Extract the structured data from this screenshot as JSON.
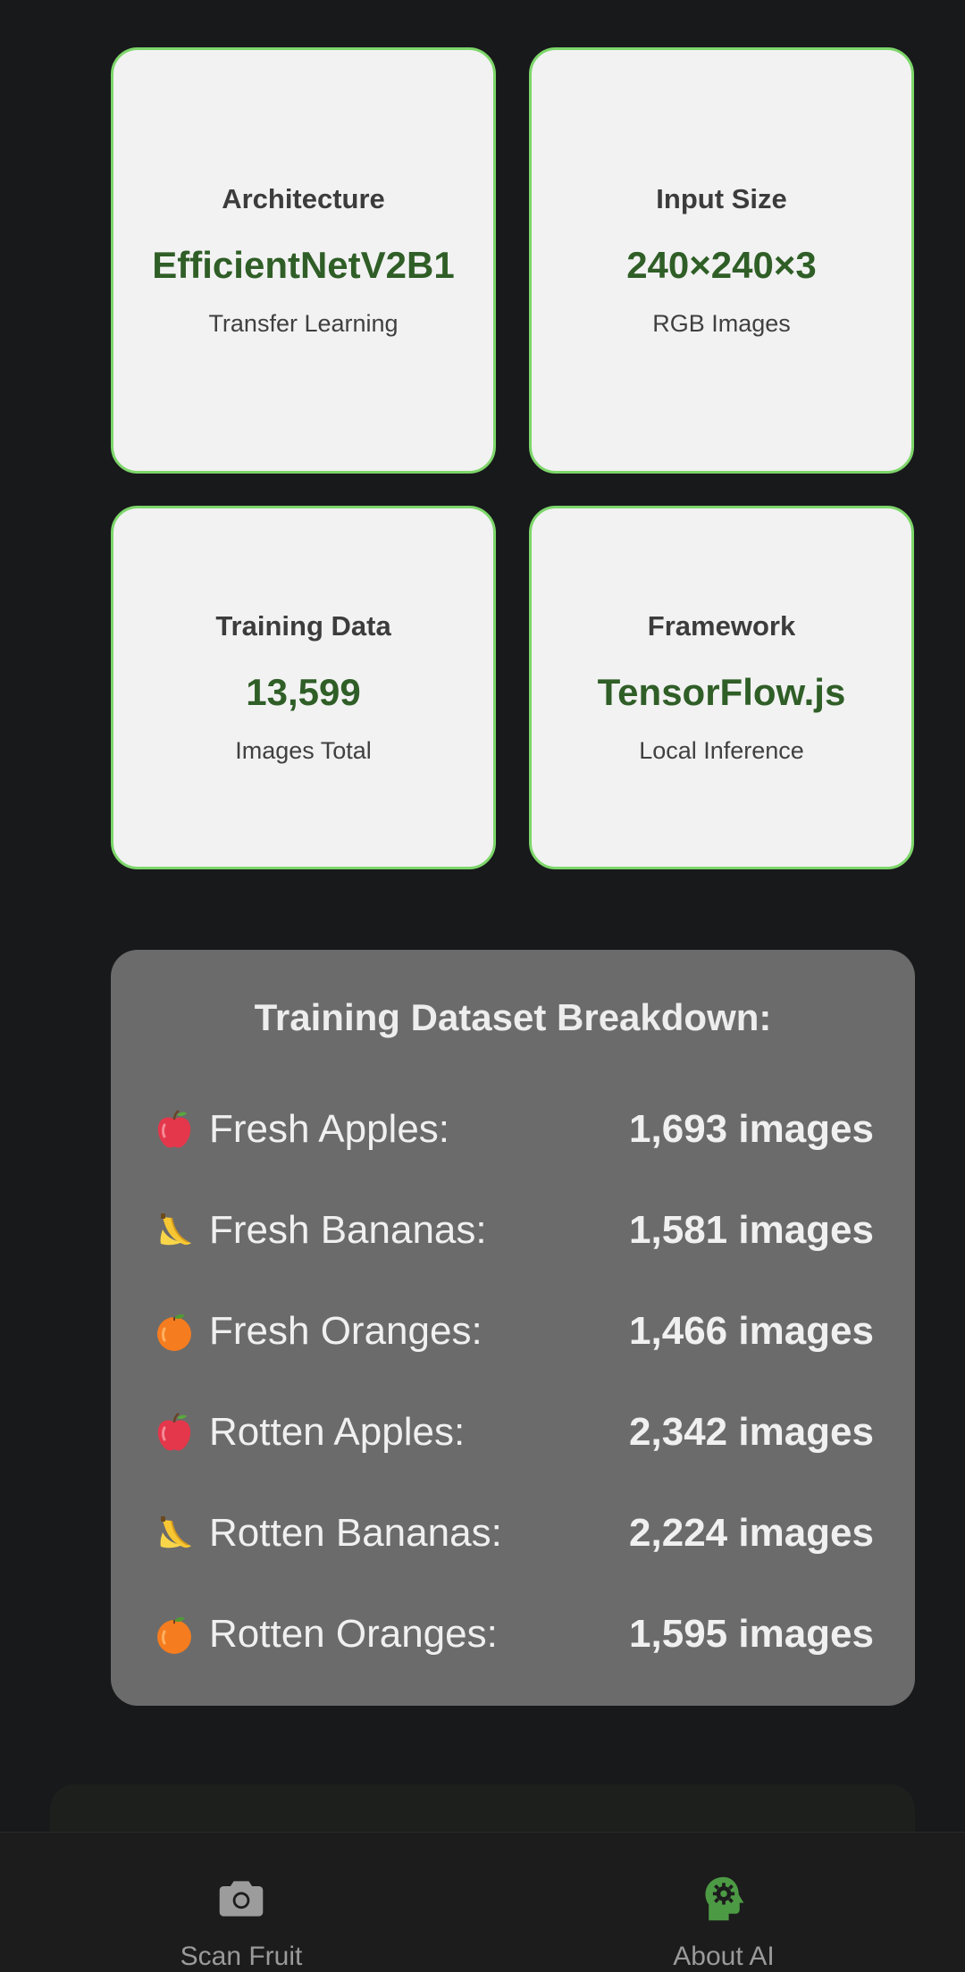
{
  "cards": [
    {
      "label": "Architecture",
      "value": "EfficientNetV2B1",
      "sub": "Transfer Learning"
    },
    {
      "label": "Input Size",
      "value": "240×240×3",
      "sub": "RGB Images"
    },
    {
      "label": "Training Data",
      "value": "13,599",
      "sub": "Images Total"
    },
    {
      "label": "Framework",
      "value": "TensorFlow.js",
      "sub": "Local Inference"
    }
  ],
  "breakdown": {
    "title": "Training Dataset Breakdown:",
    "rows": [
      {
        "icon": "apple-icon",
        "label": "Fresh Apples:",
        "count": "1,693 images"
      },
      {
        "icon": "banana-icon",
        "label": "Fresh Bananas:",
        "count": "1,581 images"
      },
      {
        "icon": "orange-icon",
        "label": "Fresh Oranges:",
        "count": "1,466 images"
      },
      {
        "icon": "apple-icon",
        "label": "Rotten Apples:",
        "count": "2,342 images"
      },
      {
        "icon": "banana-icon",
        "label": "Rotten Bananas:",
        "count": "2,224 images"
      },
      {
        "icon": "orange-icon",
        "label": "Rotten Oranges:",
        "count": "1,595 images"
      }
    ]
  },
  "nav": {
    "items": [
      {
        "icon": "camera-icon",
        "label": "Scan Fruit",
        "active": false
      },
      {
        "icon": "ai-head-icon",
        "label": "About AI",
        "active": true
      }
    ]
  },
  "colors": {
    "accent": "#7dd66a",
    "value_green": "#2f5e27",
    "active_nav": "#4d9a45",
    "background": "#18191b"
  }
}
